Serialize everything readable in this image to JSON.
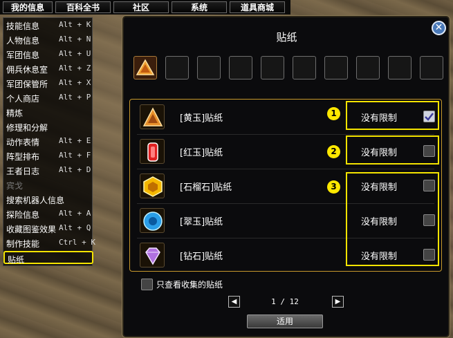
{
  "top_menu": [
    "我的信息",
    "百科全书",
    "社区",
    "系统",
    "道具商城"
  ],
  "left_menu": [
    {
      "label": "技能信息",
      "shortcut": "Alt + K"
    },
    {
      "label": "人物信息",
      "shortcut": "Alt + N"
    },
    {
      "label": "军团信息",
      "shortcut": "Alt + U"
    },
    {
      "label": "佣兵休息室",
      "shortcut": "Alt + Z"
    },
    {
      "label": "军团保管所",
      "shortcut": "Alt + X"
    },
    {
      "label": "个人商店",
      "shortcut": "Alt + P"
    },
    {
      "label": "精炼",
      "shortcut": ""
    },
    {
      "label": "修理和分解",
      "shortcut": ""
    },
    {
      "label": "动作表情",
      "shortcut": "Alt + E"
    },
    {
      "label": "阵型排布",
      "shortcut": "Alt + F"
    },
    {
      "label": "王者日志",
      "shortcut": "Alt + D"
    },
    {
      "label": "宾戈",
      "shortcut": "",
      "disabled": true
    },
    {
      "label": "搜索机器人信息",
      "shortcut": ""
    },
    {
      "label": "探险信息",
      "shortcut": "Alt + A"
    },
    {
      "label": "收藏图鉴效果",
      "shortcut": "Alt + Q"
    },
    {
      "label": "制作技能",
      "shortcut": "Ctrl + K"
    },
    {
      "label": "贴纸",
      "shortcut": "",
      "selected": true
    }
  ],
  "panel": {
    "title": "贴纸",
    "close_icon": "close-icon"
  },
  "slots": [
    {
      "filled": true,
      "icon": "topaz-sticker-icon"
    },
    {
      "filled": false
    },
    {
      "filled": false
    },
    {
      "filled": false
    },
    {
      "filled": false
    },
    {
      "filled": false
    },
    {
      "filled": false
    },
    {
      "filled": false
    },
    {
      "filled": false
    },
    {
      "filled": false
    }
  ],
  "stickers": [
    {
      "name": "[黄玉]贴纸",
      "limit": "没有限制",
      "checked": true,
      "icon": "topaz-icon",
      "color": "#e8902a"
    },
    {
      "name": "[红玉]贴纸",
      "limit": "没有限制",
      "checked": false,
      "icon": "ruby-icon",
      "color": "#e02020"
    },
    {
      "name": "[石榴石]贴纸",
      "limit": "没有限制",
      "checked": false,
      "icon": "garnet-icon",
      "color": "#f5b800"
    },
    {
      "name": "[翠玉]贴纸",
      "limit": "没有限制",
      "checked": false,
      "icon": "emerald-icon",
      "color": "#2a9ee8"
    },
    {
      "name": "[钻石]贴纸",
      "limit": "没有限制",
      "checked": false,
      "icon": "diamond-icon",
      "color": "#b070e0"
    }
  ],
  "annotations": [
    "1",
    "2",
    "3"
  ],
  "footer": {
    "only_collected_label": "只查看收集的贴纸",
    "page": "1 / 12",
    "apply_label": "适用"
  },
  "colors": {
    "highlight": "#f5e400",
    "panel_border": "#c99a2c"
  }
}
